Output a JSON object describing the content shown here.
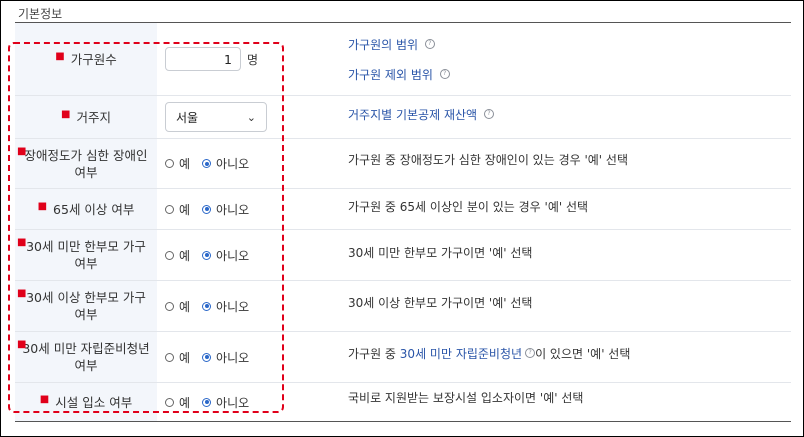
{
  "section": {
    "title": "기본정보"
  },
  "rows": [
    {
      "label": "가구원수",
      "input_value": "1",
      "unit": "명",
      "desc_links": [
        "가구원의 범위",
        "가구원 제외 범위"
      ]
    },
    {
      "label": "거주지",
      "select_value": "서울",
      "desc_link": "거주지별 기본공제 재산액"
    },
    {
      "label": "장애정도가 심한 장애인 여부",
      "yes": "예",
      "no": "아니오",
      "selected": "no",
      "desc": "가구원 중 장애정도가 심한 장애인이 있는 경우 '예' 선택"
    },
    {
      "label": "65세 이상 여부",
      "yes": "예",
      "no": "아니오",
      "selected": "no",
      "desc": "가구원 중 65세 이상인 분이 있는 경우 '예' 선택"
    },
    {
      "label": "30세 미만 한부모 가구 여부",
      "yes": "예",
      "no": "아니오",
      "selected": "no",
      "desc": "30세 미만 한부모 가구이면 '예' 선택"
    },
    {
      "label": "30세 이상 한부모 가구 여부",
      "yes": "예",
      "no": "아니오",
      "selected": "no",
      "desc": "30세 이상 한부모 가구이면 '예' 선택"
    },
    {
      "label": "30세 미만 자립준비청년 여부",
      "yes": "예",
      "no": "아니오",
      "selected": "no",
      "desc_pre": "가구원 중 ",
      "desc_link": "30세 미만 자립준비청년",
      "desc_post": "이 있으면 '예' 선택"
    },
    {
      "label": "시설 입소 여부",
      "yes": "예",
      "no": "아니오",
      "selected": "no",
      "desc": "국비로 지원받는 보장시설 입소자이면 '예' 선택"
    }
  ],
  "colors": {
    "required": "#e0001a",
    "link": "#2a55a8",
    "radio_on": "#2b68c9",
    "highlight": "#e0001a"
  },
  "icons": {
    "help": "question-circle-icon",
    "dropdown": "chevron-down-icon"
  }
}
